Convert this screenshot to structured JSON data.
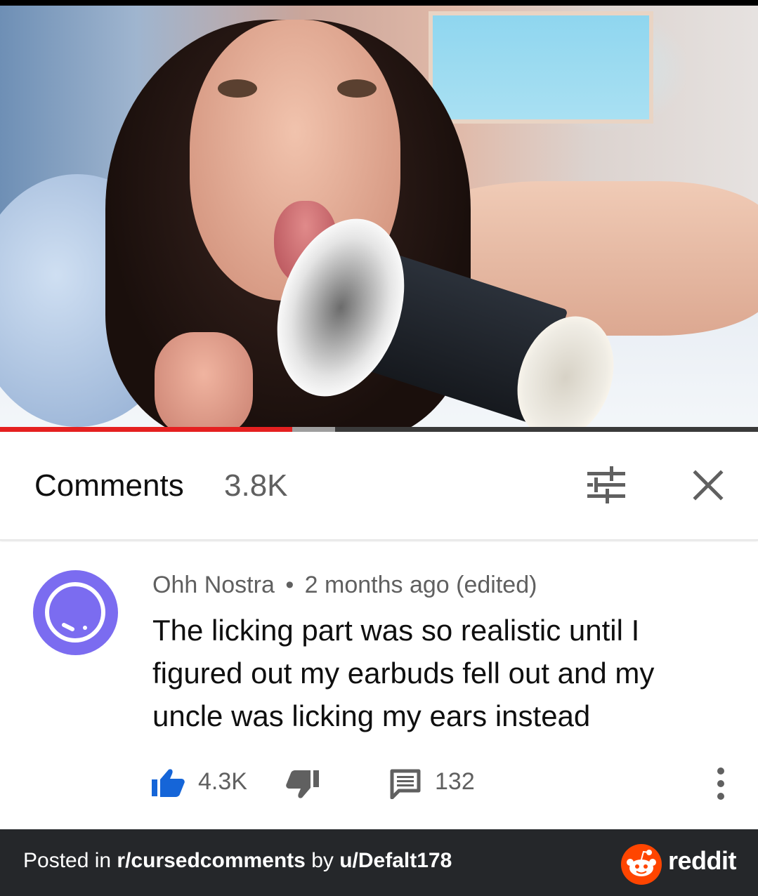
{
  "video": {
    "progress_played": 0.386,
    "progress_buffered": 0.442,
    "played_color": "#e52020"
  },
  "comments_header": {
    "title": "Comments",
    "count": "3.8K",
    "filter_icon": "sliders-icon",
    "close_icon": "close-icon"
  },
  "comment": {
    "avatar_color": "#7b6cf0",
    "author": "Ohh Nostra",
    "separator": "•",
    "time": "2 months ago (edited)",
    "text": "The licking part was so realistic until I figured out my earbuds fell out and my uncle was licking my ears instead",
    "likes": "4.3K",
    "replies": "132",
    "like_color": "#1565d8"
  },
  "footer": {
    "posted_in": "Posted in ",
    "subreddit": "r/cursedcomments",
    "by": " by ",
    "user": "u/Defalt178",
    "brand": "reddit",
    "brand_color": "#ff4500"
  }
}
